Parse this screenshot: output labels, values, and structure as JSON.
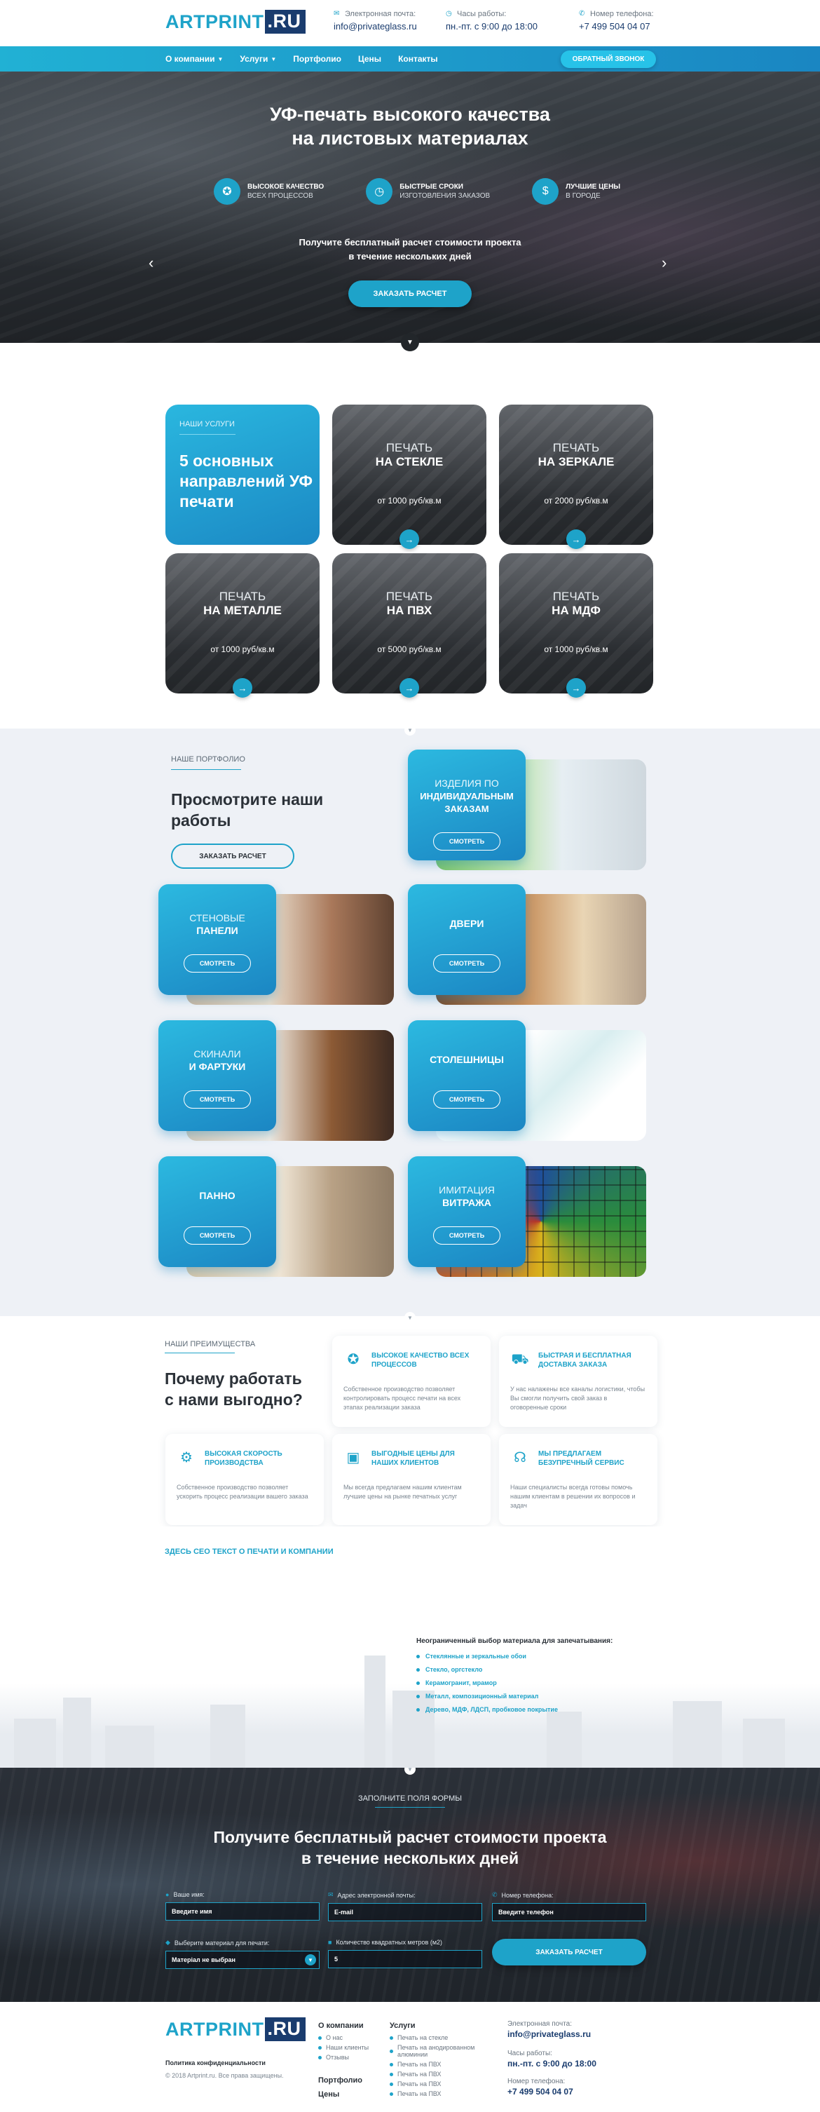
{
  "brand": {
    "logo_part1": "ARTPRINT",
    "logo_part2": ".RU",
    "primary": "#1ea3c9",
    "dark": "#1a3c6e"
  },
  "header": {
    "email_label": "Электронная почта:",
    "email": "info@privateglass.ru",
    "hours_label": "Часы работы:",
    "hours": "пн.-пт. с 9:00 до 18:00",
    "phone_label": "Номер телефона:",
    "phone": "+7 499 504 04 07"
  },
  "nav": {
    "items": [
      "О компании",
      "Услуги",
      "Портфолио",
      "Цены",
      "Контакты"
    ],
    "callback": "ОБРАТНЫЙ ЗВОНОК"
  },
  "hero": {
    "title_line1": "УФ-печать высокого качества",
    "title_line2": "на листовых материалах",
    "features": [
      {
        "icon": "medal-icon",
        "t1": "ВЫСОКОЕ КАЧЕСТВО",
        "t2": "ВСЕХ ПРОЦЕССОВ"
      },
      {
        "icon": "clock-icon",
        "t1": "БЫСТРЫЕ СРОКИ",
        "t2": "ИЗГОТОВЛЕНИЯ ЗАКАЗОВ"
      },
      {
        "icon": "dollar-icon",
        "t1": "ЛУЧШИЕ ЦЕНЫ",
        "t2": "В ГОРОДЕ"
      }
    ],
    "sub_line1": "Получите бесплатный расчет стоимости проекта",
    "sub_line2": "в течение нескольких дней",
    "cta": "ЗАКАЗАТЬ РАСЧЕТ"
  },
  "services": {
    "eyebrow": "НАШИ УСЛУГИ",
    "headline": "5 основных направлений УФ печати",
    "items": [
      {
        "l1": "ПЕЧАТЬ",
        "l2": "НА СТЕКЛЕ",
        "price": "от 1000 руб/кв.м"
      },
      {
        "l1": "ПЕЧАТЬ",
        "l2": "НА ЗЕРКАЛЕ",
        "price": "от 2000 руб/кв.м"
      },
      {
        "l1": "ПЕЧАТЬ",
        "l2": "НА МЕТАЛЛЕ",
        "price": "от 1000 руб/кв.м"
      },
      {
        "l1": "ПЕЧАТЬ",
        "l2": "НА ПВХ",
        "price": "от 5000 руб/кв.м"
      },
      {
        "l1": "ПЕЧАТЬ",
        "l2": "НА МДФ",
        "price": "от 1000 руб/кв.м"
      }
    ]
  },
  "portfolio": {
    "eyebrow": "НАШЕ ПОРТФОЛИО",
    "title_line1": "Просмотрите наши",
    "title_line2": "работы",
    "cta": "ЗАКАЗАТЬ РАСЧЕТ",
    "view": "СМОТРЕТЬ",
    "items": [
      {
        "l1": "ИЗДЕЛИЯ ПО",
        "l2": "ИНДИВИДУАЛЬНЫМ ЗАКАЗАМ"
      },
      {
        "l1": "СТЕНОВЫЕ",
        "l2": "ПАНЕЛИ"
      },
      {
        "l1": "",
        "l2": "ДВЕРИ"
      },
      {
        "l1": "СКИНАЛИ",
        "l2": "И ФАРТУКИ"
      },
      {
        "l1": "",
        "l2": "СТОЛЕШНИЦЫ"
      },
      {
        "l1": "",
        "l2": "ПАННО"
      },
      {
        "l1": "ИМИТАЦИЯ",
        "l2": "ВИТРАЖА"
      }
    ]
  },
  "advantages": {
    "eyebrow": "НАШИ ПРЕИМУЩЕСТВА",
    "title_line1": "Почему работать",
    "title_line2": "с нами выгодно?",
    "items": [
      {
        "icon": "medal-icon",
        "title": "ВЫСОКОЕ КАЧЕСТВО ВСЕХ ПРОЦЕССОВ",
        "desc": "Собственное производство позволяет контролировать процесс печати на всех этапах реализации заказа"
      },
      {
        "icon": "truck-icon",
        "title": "БЫСТРАЯ И БЕСПЛАТНАЯ ДОСТАВКА ЗАКАЗА",
        "desc": "У нас налажены все каналы логистики, чтобы Вы смогли получить свой заказ в оговоренные сроки"
      },
      {
        "icon": "factory-icon",
        "title": "ВЫСОКАЯ СКОРОСТЬ ПРОИЗВОДСТВА",
        "desc": "Собственное производство позволяет ускорить процесс реализации вашего заказа"
      },
      {
        "icon": "wallet-icon",
        "title": "ВЫГОДНЫЕ ЦЕНЫ ДЛЯ НАШИХ КЛИЕНТОВ",
        "desc": "Мы всегда предлагаем нашим клиентам лучшие цены на рынке печатных услуг"
      },
      {
        "icon": "headset-icon",
        "title": "МЫ ПРЕДЛАГАЕМ БЕЗУПРЕЧНЫЙ СЕРВИС",
        "desc": "Наши специалисты всегда готовы помочь нашим клиентам в решении их вопросов и задач"
      }
    ]
  },
  "seo": {
    "heading": "ЗДЕСЬ СЕО ТЕКСТ О ПЕЧАТИ И КОМПАНИИ",
    "list_title": "Неограниченный выбор материала для запечатывания:",
    "list": [
      "Стеклянные и зеркальные обои",
      "Стекло, оргстекло",
      "Керамогранит, мрамор",
      "Металл, композиционный материал",
      "Дерево, МДФ, ЛДСП, пробковое покрытие"
    ]
  },
  "form": {
    "eyebrow": "ЗАПОЛНИТЕ ПОЛЯ ФОРМЫ",
    "title_line1": "Получите бесплатный расчет стоимости проекта",
    "title_line2": "в течение нескольких дней",
    "fields": [
      {
        "label": "Ваше имя:",
        "placeholder": "Введите имя"
      },
      {
        "label": "Адрес электронной почты:",
        "placeholder": "E-mail"
      },
      {
        "label": "Номер телефона:",
        "placeholder": "Введите телефон"
      },
      {
        "label": "Выберите материал для печати:",
        "placeholder": "Матерiал не выбран"
      },
      {
        "label": "Количество квадратных метров (м2)",
        "placeholder": "5"
      }
    ],
    "submit": "ЗАКАЗАТЬ РАСЧЕТ"
  },
  "footer": {
    "policy": "Политика конфиденциальности",
    "copyright": "© 2018 Artprint.ru. Все права защищены.",
    "col1_title": "О компании",
    "col1_items": [
      "О нас",
      "Наши клиенты",
      "Отзывы"
    ],
    "col1_title2": "Портфолио",
    "col1_title3": "Цены",
    "col2_title": "Услуги",
    "col2_items": [
      "Печать на стекле",
      "Печать на анодированном алюминии",
      "Печать на ПВХ",
      "Печать на ПВХ",
      "Печать на ПВХ",
      "Печать на ПВХ"
    ],
    "email_label": "Электронная почта:",
    "email": "info@privateglass.ru",
    "hours_label": "Часы работы:",
    "hours": "пн.-пт. с 9:00 до 18:00",
    "phone_label": "Номер телефона:",
    "phone": "+7 499 504 04 07"
  }
}
